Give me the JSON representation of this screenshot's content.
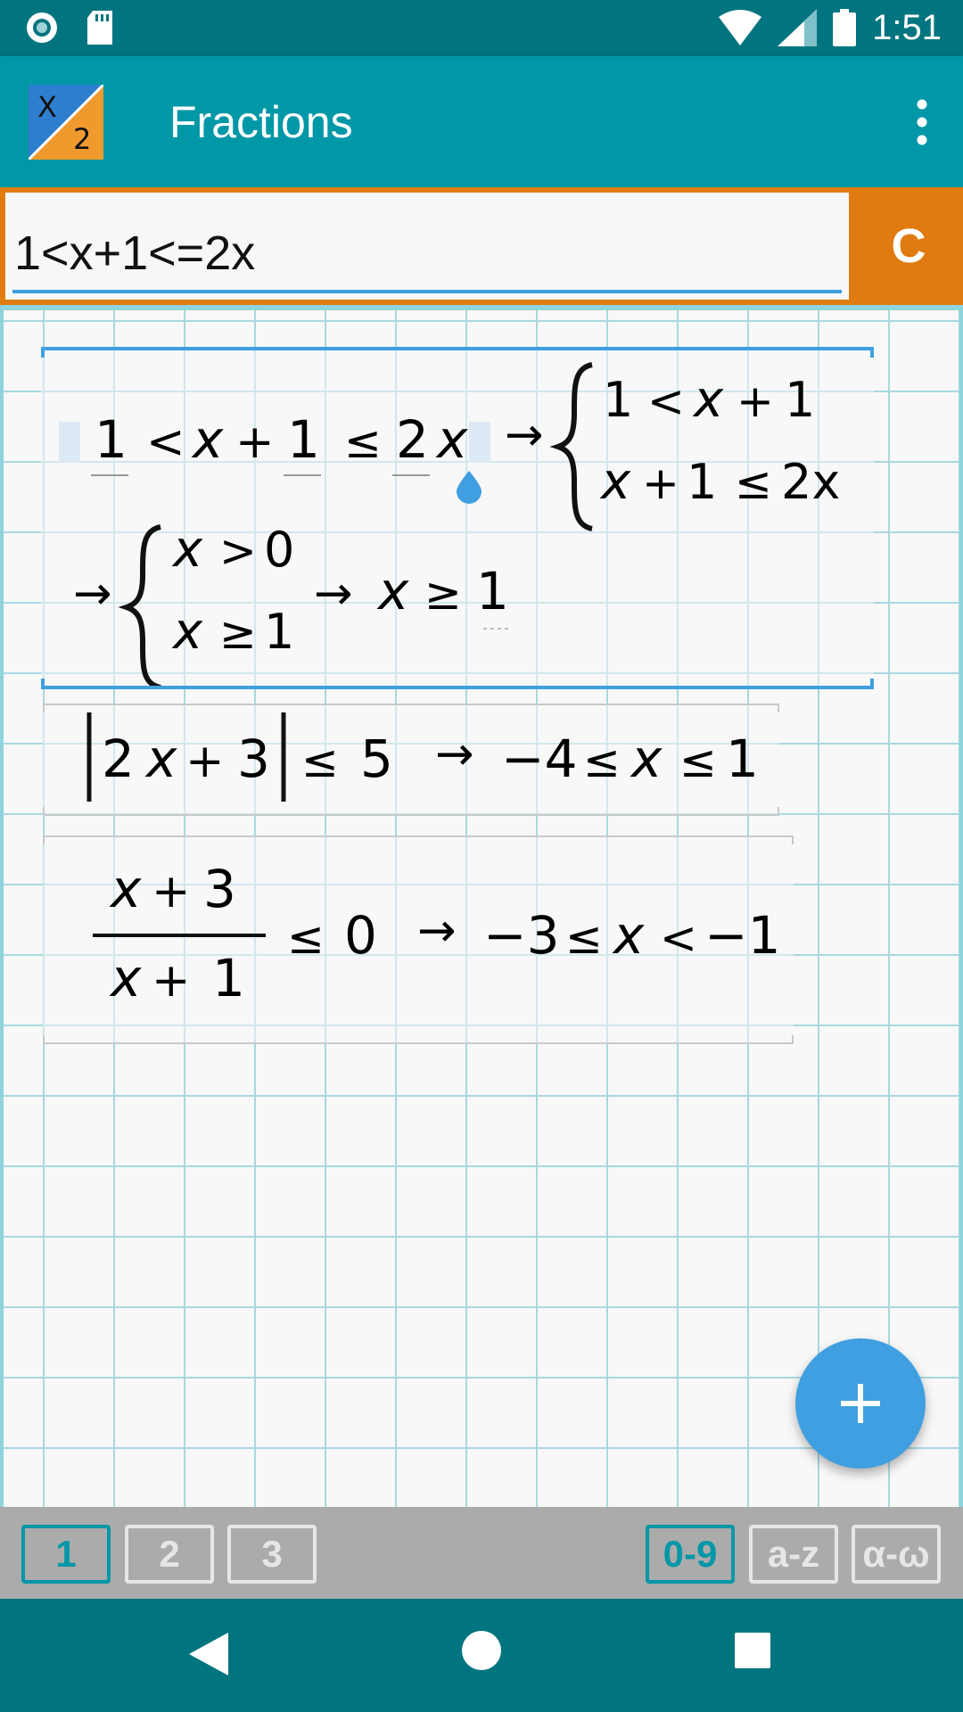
{
  "status_bar": {
    "time": "1:51"
  },
  "app_bar": {
    "title": "Fractions"
  },
  "input": {
    "value": "1<x+1<=2x",
    "clear_label": "C"
  },
  "results": [
    {
      "active": true,
      "line1": {
        "lhs": [
          "1",
          "<",
          "x",
          "+",
          "1",
          "≤",
          "2",
          "x"
        ],
        "arrow": "→",
        "system": [
          [
            "1",
            "<",
            "x",
            "+",
            "1"
          ],
          [
            "x",
            "+",
            "1",
            "≤",
            "2x"
          ]
        ]
      },
      "line2": {
        "arrow": "→",
        "system": [
          [
            "x",
            ">",
            "0"
          ],
          [
            "x",
            "≥",
            "1"
          ]
        ],
        "arrow2": "→",
        "result": [
          "x",
          "≥",
          "1"
        ]
      }
    },
    {
      "active": false,
      "expr": {
        "abs_content": [
          "2",
          "x",
          "+",
          "3"
        ],
        "op": "≤",
        "rhs": "5",
        "arrow": "→",
        "result": [
          "−4",
          "≤",
          "x",
          "≤",
          "1"
        ]
      }
    },
    {
      "active": false,
      "expr": {
        "numerator": [
          "x",
          "+",
          "3"
        ],
        "denominator": [
          "x",
          "+",
          "1"
        ],
        "op": "≤",
        "rhs": "0",
        "arrow": "→",
        "result": [
          "−3",
          "≤",
          "x",
          "<",
          "−1"
        ]
      }
    }
  ],
  "fab": {
    "icon": "plus-icon"
  },
  "keypad": {
    "pages": [
      "1",
      "2",
      "3"
    ],
    "active_page": "1",
    "modes": [
      "0-9",
      "a-z",
      "α-ω"
    ],
    "active_mode": "0-9"
  },
  "colors": {
    "status_bar": "#00757f",
    "app_bar": "#0097a7",
    "accent_orange": "#e07b12",
    "accent_blue": "#3f9fe0",
    "grid_line": "#a8d8e0",
    "keypad_bg": "#ababab"
  }
}
